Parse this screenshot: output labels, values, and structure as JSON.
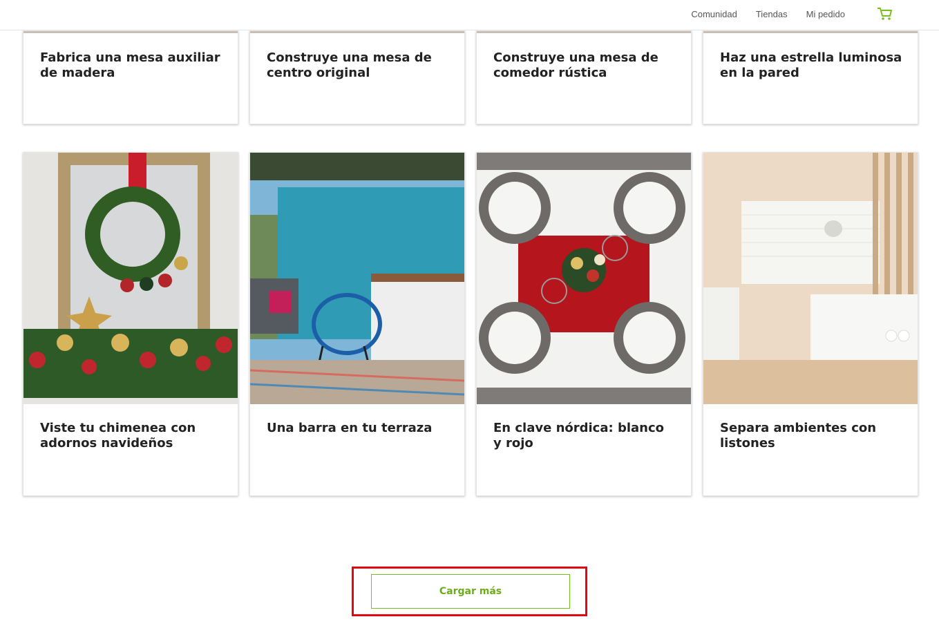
{
  "header": {
    "nav": [
      "Comunidad",
      "Tiendas",
      "Mi pedido"
    ],
    "cart_icon": "cart-icon",
    "accent": "#78be20"
  },
  "cards_row1": [
    {
      "title": "Fabrica una mesa auxiliar de madera"
    },
    {
      "title": "Construye una mesa de centro original"
    },
    {
      "title": "Construye una mesa de comedor rústica"
    },
    {
      "title": "Haz una estrella luminosa en la pared"
    }
  ],
  "cards_row2": [
    {
      "title": "Viste tu chimenea con adornos navideños",
      "image": "christmas-wreath-mirror-image"
    },
    {
      "title": "Una barra en tu terraza",
      "image": "terrace-bar-image"
    },
    {
      "title": "En clave nórdica: blanco y rojo",
      "image": "nordic-table-setting-image"
    },
    {
      "title": "Separa ambientes con listones",
      "image": "kitchen-slats-image"
    }
  ],
  "load_more": {
    "label": "Cargar más",
    "highlight_color": "#e30613"
  }
}
